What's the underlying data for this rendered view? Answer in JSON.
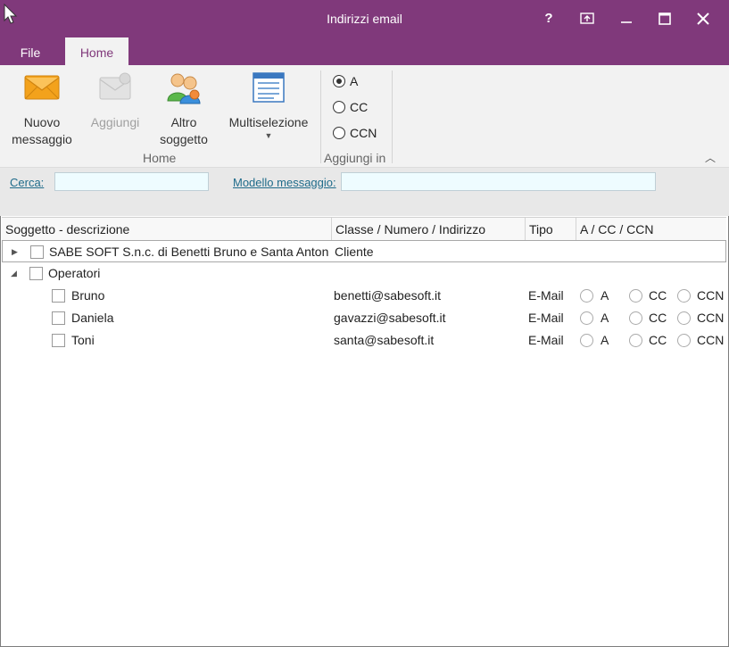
{
  "window": {
    "title": "Indirizzi email",
    "help": "?",
    "restore": "⧉",
    "minimize": "—",
    "maximize": "☐",
    "close": "✕"
  },
  "menu": {
    "file": "File",
    "home": "Home"
  },
  "ribbon": {
    "home_group": {
      "label": "Home",
      "buttons": [
        {
          "label": "Nuovo messaggio",
          "icon": "envelope-icon",
          "enabled": true
        },
        {
          "label": "Aggiungi",
          "icon": "add-mail-icon",
          "enabled": false
        },
        {
          "label": "Altro soggetto",
          "icon": "people-icon",
          "enabled": true
        },
        {
          "label": "Multiselezione",
          "icon": "list-icon",
          "enabled": true
        }
      ]
    },
    "add_group": {
      "label": "Aggiungi in",
      "options": [
        "A",
        "CC",
        "CCN"
      ],
      "selected": "A"
    }
  },
  "search": {
    "label": "Cerca:",
    "value": "",
    "template_label": "Modello messaggio:",
    "template_value": ""
  },
  "grid": {
    "columns": [
      "Soggetto - descrizione",
      "Classe / Numero / Indirizzo",
      "Tipo",
      "A / CC / CCN"
    ],
    "rows": [
      {
        "name": "SABE SOFT S.n.c. di Benetti Bruno e Santa Anton",
        "class": "Cliente",
        "level": 0,
        "expander": "collapsed"
      },
      {
        "name": "Operatori",
        "class": "",
        "level": 0,
        "expander": "expanded"
      },
      {
        "name": "Bruno",
        "class": "benetti@sabesoft.it",
        "tipo": "E-Mail",
        "level": 1
      },
      {
        "name": "Daniela",
        "class": "gavazzi@sabesoft.it",
        "tipo": "E-Mail",
        "level": 1
      },
      {
        "name": "Toni",
        "class": "santa@sabesoft.it",
        "tipo": "E-Mail",
        "level": 1
      }
    ],
    "radio_labels": [
      "A",
      "CC",
      "CCN"
    ]
  },
  "colors": {
    "accent": "#80397b",
    "ribbon_bg": "#f2f2f2",
    "input_bg": "#eefcff"
  }
}
